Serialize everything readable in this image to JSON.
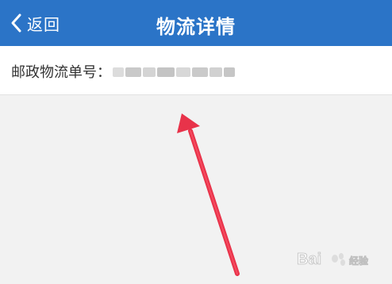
{
  "header": {
    "back_label": "返回",
    "title": "物流详情",
    "color": "#2b74c7"
  },
  "tracking": {
    "label": "邮政物流单号："
  },
  "annotation": {
    "arrow_color": "#e8334a"
  }
}
